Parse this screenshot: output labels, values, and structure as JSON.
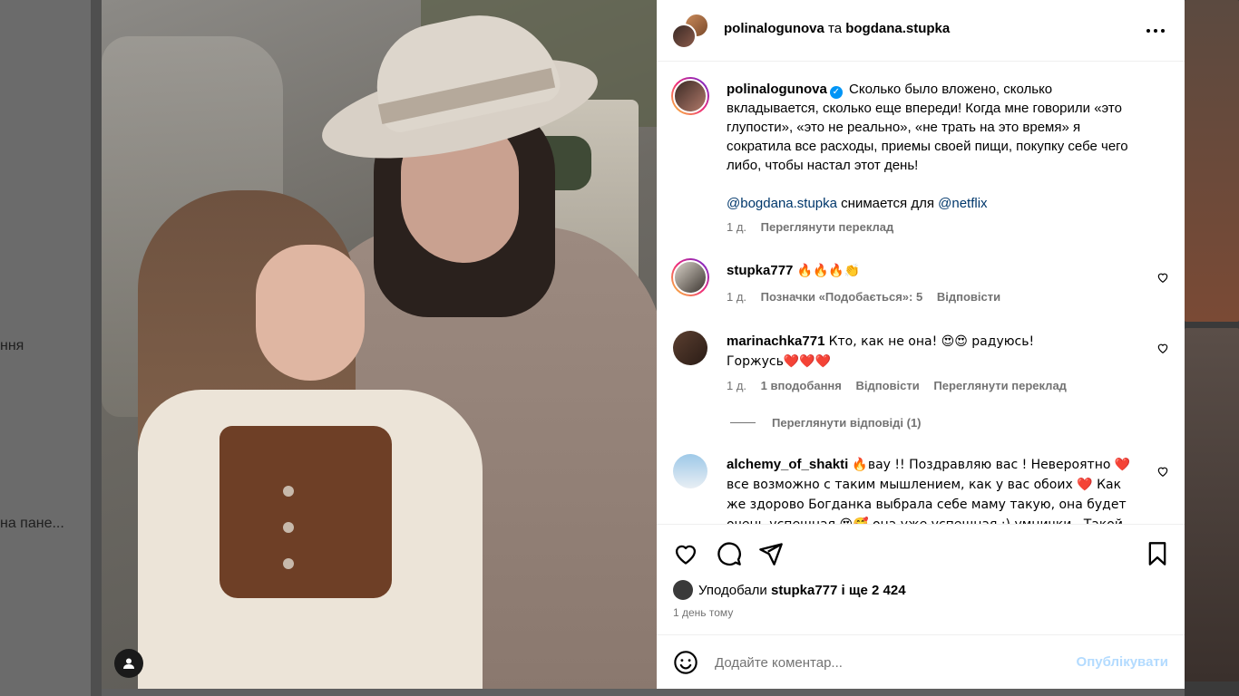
{
  "background": {
    "left_text_1": "ння",
    "left_text_2": "на пане..."
  },
  "header": {
    "user1": "polinalogunova",
    "separator": "та",
    "user2": "bogdana.stupka"
  },
  "caption": {
    "username": "polinalogunova",
    "text": "Сколько было вложено, сколько вкладывается, сколько еще впереди! Когда мне говорили «это глупости», «это не реально», «не трать на это время» я сократила все расходы, приемы своей пищи, покупку себе чего либо, чтобы настал этот день!",
    "mention1": "@bogdana.stupka",
    "mid_text": "снимается для",
    "mention2": "@netflix",
    "age": "1 д.",
    "translate": "Переглянути переклад"
  },
  "comments": [
    {
      "username": "stupka777",
      "text": "🔥🔥🔥👏",
      "age": "1 д.",
      "likes_label": "Позначки «Подобається»: 5",
      "reply": "Відповісти"
    },
    {
      "username": "marinachka771",
      "text": "Кто, как не она! 😍😍 радуюсь! Горжусь❤️❤️❤️",
      "age": "1 д.",
      "likes_label": "1 вподобання",
      "reply": "Відповісти",
      "translate": "Переглянути переклад",
      "view_replies": "Переглянути відповіді (1)"
    },
    {
      "username": "alchemy_of_shakti",
      "text": "🔥вау !! Поздравляю вас ! Невероятно ❤️ все возможно с таким мышлением, как у вас обоих ❤️ Как же здорово Богданка выбрала себе маму такую, она будет очень успешная 😍🥰 она уже успешная :) умнички . Такой"
    }
  ],
  "likes": {
    "prefix": "Уподобали",
    "user": "stupka777",
    "suffix": "і ще 2 424"
  },
  "time_ago": "1 день тому",
  "add_comment": {
    "placeholder": "Додайте коментар...",
    "publish": "Опублікувати"
  },
  "colors": {
    "link": "#00376b",
    "meta": "#737373",
    "verified": "#0095f6",
    "publish_disabled": "#b3dbff"
  },
  "icons": [
    "more-icon",
    "verified-icon",
    "heart-icon",
    "comment-icon",
    "share-icon",
    "bookmark-icon",
    "emoji-icon",
    "user-tag-icon"
  ]
}
